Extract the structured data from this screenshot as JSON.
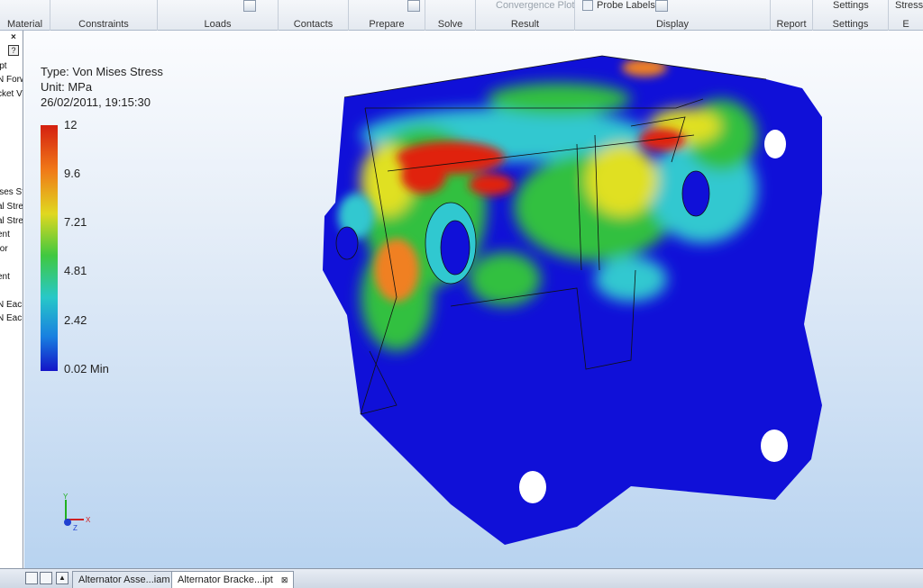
{
  "ribbon": {
    "top_items": {
      "convergence_plot": "Convergence Plot",
      "probe_labels": "Probe Labels",
      "settings": "Settings",
      "stress": "Stress..."
    },
    "groups": [
      "Material",
      "Constraints",
      "Loads",
      "Contacts",
      "Prepare",
      "Solve",
      "Result",
      "Display",
      "Report",
      "Settings",
      "E"
    ]
  },
  "browser": {
    "close": "×",
    "help": "?",
    "items": [
      "ipt",
      "N Forw",
      "cket V",
      "ises Str",
      "al Stre",
      "al Stre",
      "ent",
      "tor",
      "ent",
      "N Each",
      "N Each"
    ]
  },
  "legend": {
    "type": "Type: Von Mises Stress",
    "unit": "Unit: MPa",
    "date": "26/02/2011, 19:15:30",
    "ticks": [
      "12",
      "9.6",
      "7.21",
      "4.81",
      "2.42",
      "0.02 Min"
    ]
  },
  "triad": {
    "x": "X",
    "y": "Y",
    "z": "Z"
  },
  "tabs": {
    "doc1": "Alternator Asse...iam",
    "doc2": "Alternator Bracke...ipt",
    "doc2_close": "⊠"
  },
  "colors": {
    "mesh_blue": "#1010d8",
    "stress_red": "#e02010",
    "stress_orange": "#f08020",
    "stress_yellow": "#e0e020",
    "stress_green": "#30c040",
    "stress_cyan": "#30c8d0",
    "viewport_top": "#fbfcfe",
    "viewport_bottom": "#b8d3f0"
  }
}
